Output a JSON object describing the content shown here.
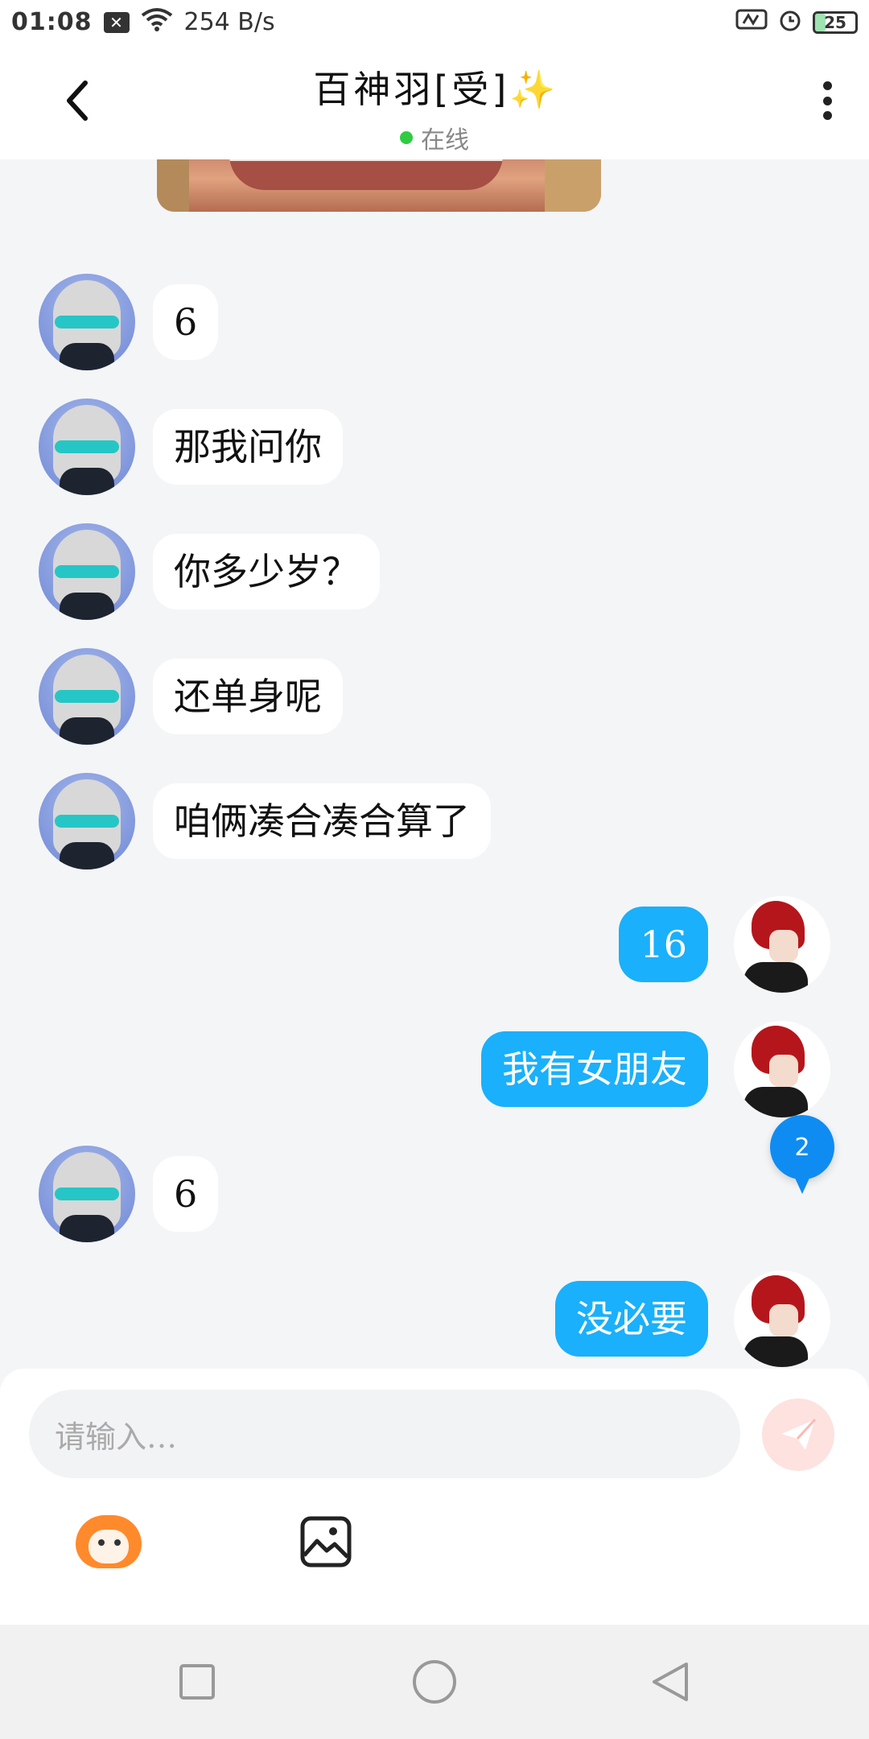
{
  "status_bar": {
    "time": "01:08",
    "net_speed": "254 B/s",
    "battery": "25",
    "battery_level_percent": 25
  },
  "header": {
    "title": "百神羽[受]",
    "title_emoji": "✨",
    "online_text": "在线"
  },
  "messages": [
    {
      "side": "in",
      "text": "6"
    },
    {
      "side": "in",
      "text": "那我问你"
    },
    {
      "side": "in",
      "text": "你多少岁？"
    },
    {
      "side": "in",
      "text": "还单身呢"
    },
    {
      "side": "in",
      "text": "咱俩凑合凑合算了"
    },
    {
      "side": "out",
      "text": "16"
    },
    {
      "side": "out",
      "text": "我有女朋友"
    },
    {
      "side": "in",
      "text": "6"
    },
    {
      "side": "out",
      "text": "没必要"
    }
  ],
  "unread_badge": "2",
  "composer": {
    "placeholder": "请输入…"
  },
  "colors": {
    "outgoing_bubble": "#1ab0fb",
    "incoming_bubble": "#ffffff",
    "online_dot": "#2ecc40",
    "badge": "#0f8cf2"
  },
  "icons": [
    "back-icon",
    "more-icon",
    "send-icon",
    "emoji-mascot-icon",
    "image-icon",
    "nav-recents-icon",
    "nav-home-icon",
    "nav-back-icon"
  ]
}
